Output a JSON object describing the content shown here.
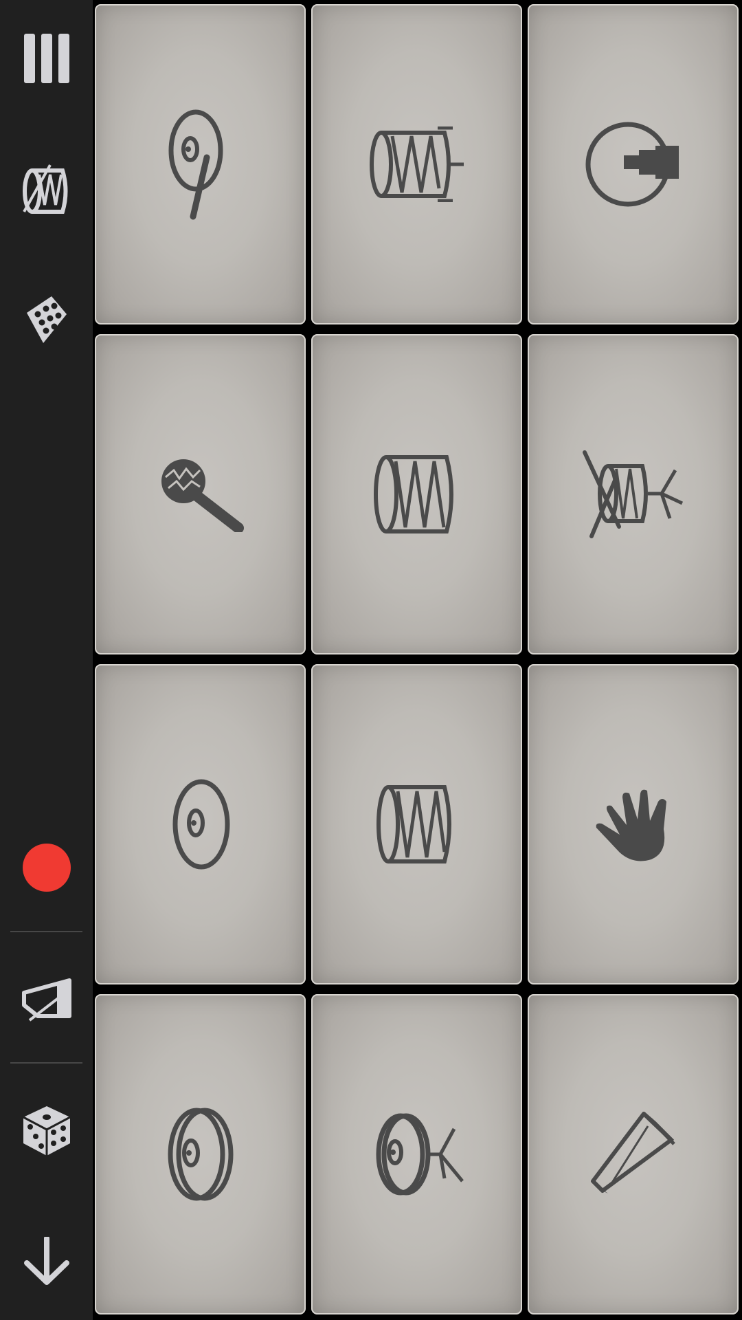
{
  "colors": {
    "sidebar_bg": "#202020",
    "grid_bg": "#000000",
    "pad_face": "#bebbb6",
    "icon_dark": "#4a4a4a",
    "icon_light": "#d4d4d8",
    "record": "#f03a32"
  },
  "sidebar": {
    "items": [
      {
        "name": "menu-bars-icon"
      },
      {
        "name": "drum-kit-icon"
      },
      {
        "name": "drum-pads-icon"
      },
      {
        "name": "record-button"
      },
      {
        "name": "metronome-icon"
      },
      {
        "name": "dice-icon"
      },
      {
        "name": "download-arrow-icon"
      }
    ]
  },
  "pads": [
    {
      "icon": "china-cymbal-icon"
    },
    {
      "icon": "snare-drum-icon"
    },
    {
      "icon": "bass-drum-icon"
    },
    {
      "icon": "maraca-icon"
    },
    {
      "icon": "tom-drum-icon"
    },
    {
      "icon": "snare-stand-icon"
    },
    {
      "icon": "crash-cymbal-icon"
    },
    {
      "icon": "floor-tom-icon"
    },
    {
      "icon": "hand-clap-icon"
    },
    {
      "icon": "ride-cymbal-icon"
    },
    {
      "icon": "hi-hat-icon"
    },
    {
      "icon": "cowbell-icon"
    }
  ]
}
